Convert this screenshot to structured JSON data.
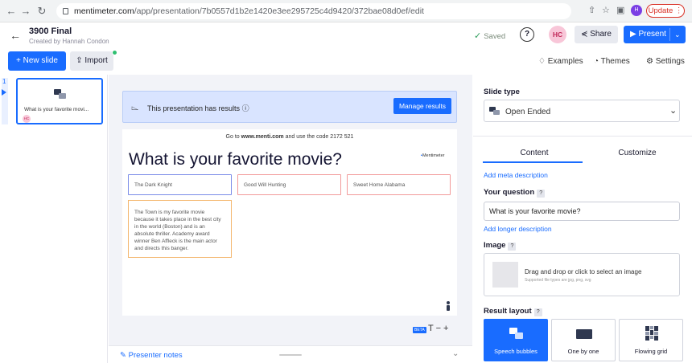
{
  "browser": {
    "url_host": "mentimeter.com",
    "url_path": "/app/presentation/7b0557d1b2e1420e3ee295725c4d9420/372bae08d0ef/edit",
    "profile_initial": "H",
    "update_label": "Update"
  },
  "header": {
    "title": "3900 Final",
    "subtitle": "Created by Hannah Condon",
    "saved_label": "Saved",
    "avatar_initials": "HC",
    "share_label": "Share",
    "present_label": "Present"
  },
  "toolbar": {
    "new_slide_label": "+ New slide",
    "import_label": "Import",
    "examples_label": "Examples",
    "themes_label": "Themes",
    "settings_label": "Settings"
  },
  "slide_list": {
    "items": [
      {
        "number": "1",
        "title": "What is your favorite movi...",
        "avatar": "HC"
      }
    ]
  },
  "canvas": {
    "banner_text": "This presentation has results",
    "manage_results_label": "Manage results",
    "instruction_prefix": "Go to ",
    "instruction_site": "www.menti.com",
    "instruction_suffix": " and use the code 2172 521",
    "question": "What is your favorite movie?",
    "logo_text": "Mentimeter",
    "responses": [
      "The Dark Knight",
      "Good Will Hunting",
      "Sweet Home Alabama",
      "The Town is my favorite movie because it takes place in the best city in the world (Boston) and is an absolute thriller. Academy award winner Ben Affleck is the main actor and directs this banger."
    ],
    "response_colors": [
      "#7b8ce8",
      "#f29a9a",
      "#f29a9a",
      "#f4b66d"
    ],
    "beta_label": "BETA",
    "text_tools": "T  −  +",
    "presenter_notes_label": "Presenter notes"
  },
  "panel": {
    "slide_type_heading": "Slide type",
    "slide_type_value": "Open Ended",
    "tabs": [
      {
        "label": "Content",
        "active": true
      },
      {
        "label": "Customize",
        "active": false
      }
    ],
    "add_meta_label": "Add meta description",
    "your_question_label": "Your question",
    "question_value": "What is your favorite movie?",
    "add_longer_label": "Add longer description",
    "image_label": "Image",
    "drop_text": "Drag and drop or click to select an image",
    "drop_subtext": "Supported file types are jpg, png, svg",
    "result_layout_label": "Result layout",
    "layouts": [
      {
        "label": "Speech bubbles",
        "selected": true
      },
      {
        "label": "One by one",
        "selected": false
      },
      {
        "label": "Flowing grid",
        "selected": false
      }
    ]
  },
  "colors": {
    "accent": "#196cff",
    "banner_bg": "#d9e4ff",
    "saved_check": "#2e9e5b"
  }
}
